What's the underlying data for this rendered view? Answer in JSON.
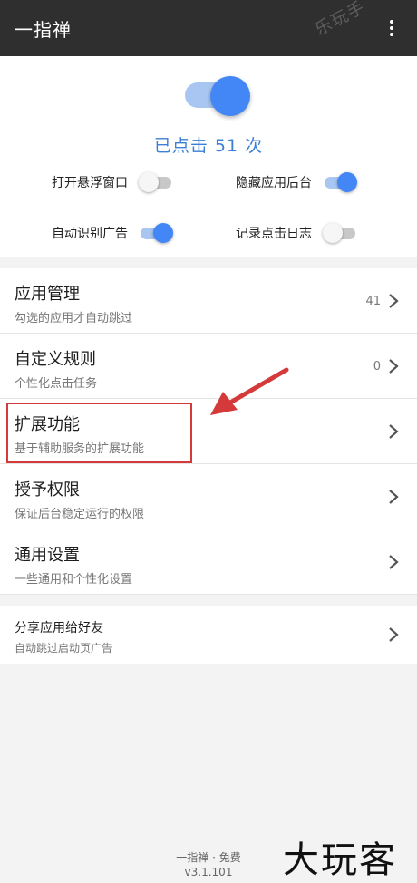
{
  "appbar": {
    "title": "一指禅",
    "more_icon": "more-vert-icon",
    "watermark": "乐玩手"
  },
  "hero": {
    "main_toggle_on": true,
    "click_count_text": "已点击 51 次",
    "options": [
      {
        "label": "打开悬浮窗口",
        "on": false
      },
      {
        "label": "隐藏应用后台",
        "on": true
      },
      {
        "label": "自动识别广告",
        "on": true
      },
      {
        "label": "记录点击日志",
        "on": false
      }
    ]
  },
  "menu": {
    "items": [
      {
        "title": "应用管理",
        "subtitle": "勾选的应用才自动跳过",
        "count": "41"
      },
      {
        "title": "自定义规则",
        "subtitle": "个性化点击任务",
        "count": "0"
      },
      {
        "title": "扩展功能",
        "subtitle": "基于辅助服务的扩展功能",
        "count": ""
      },
      {
        "title": "授予权限",
        "subtitle": "保证后台稳定运行的权限",
        "count": ""
      },
      {
        "title": "通用设置",
        "subtitle": "一些通用和个性化设置",
        "count": ""
      }
    ]
  },
  "share": {
    "title": "分享应用给好友",
    "subtitle": "自动跳过启动页广告"
  },
  "footer": {
    "line1": "一指禅 · 免费",
    "version": "v3.1.101"
  },
  "watermark_bottom": "大玩客",
  "colors": {
    "accent": "#4287f5",
    "highlight": "#d43a3a",
    "appbar": "#2f2f2f"
  }
}
